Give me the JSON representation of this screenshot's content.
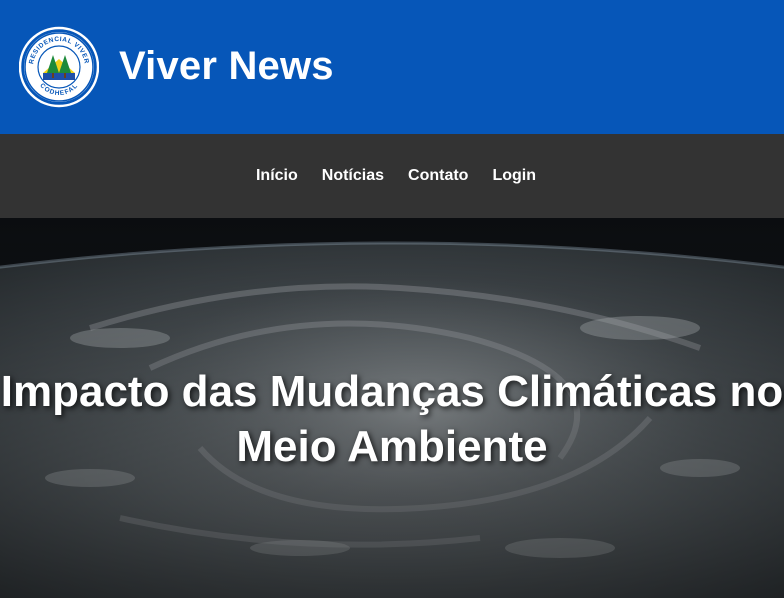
{
  "header": {
    "site_title": "Viver News",
    "logo": {
      "top_text": "RESIDENCIAL VIVER",
      "bottom_text": "CODHEFAL"
    },
    "brand_color": "#0656b8"
  },
  "nav": {
    "items": [
      {
        "label": "Início"
      },
      {
        "label": "Notícias"
      },
      {
        "label": "Contato"
      },
      {
        "label": "Login"
      }
    ],
    "background": "#333333"
  },
  "hero": {
    "title": "Impacto das Mudanças Climáticas no Meio Ambiente",
    "background_image": "earth-from-space-storm-clouds"
  }
}
